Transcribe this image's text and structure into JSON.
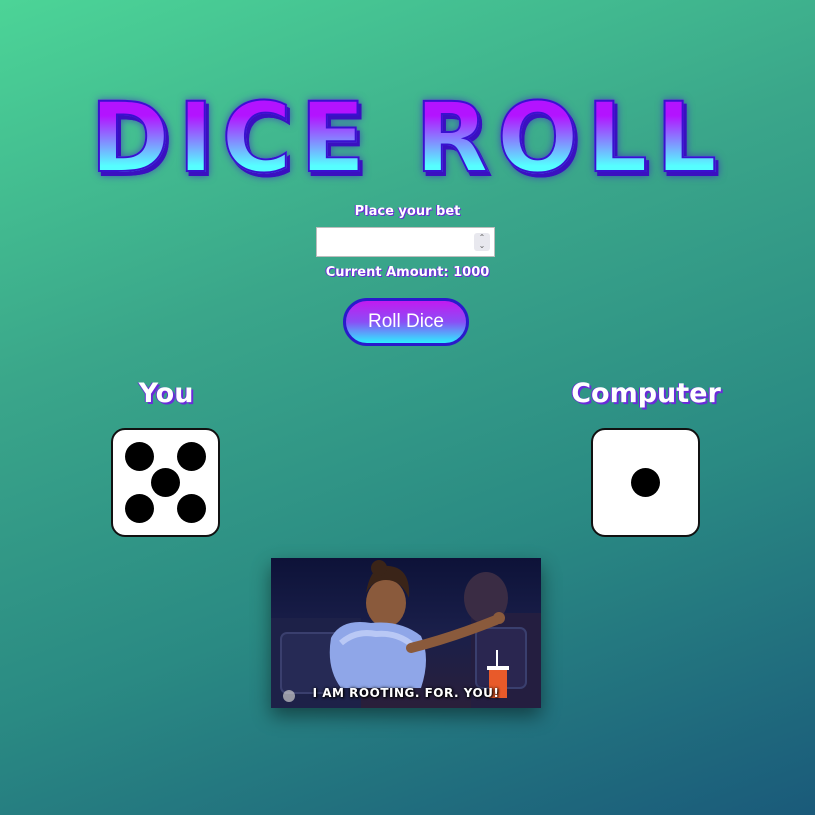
{
  "title": "DICE ROLL",
  "bet": {
    "label": "Place your bet",
    "value": "",
    "amount_line": "Current Amount: 1000"
  },
  "roll_button": {
    "label": "Roll Dice"
  },
  "players": {
    "you": {
      "label": "You",
      "die_value": 5
    },
    "computer": {
      "label": "Computer",
      "die_value": 1
    }
  },
  "gif": {
    "caption": "I AM ROOTING. FOR. YOU!",
    "network_icon": "nbc-peacock-icon"
  },
  "colors": {
    "accent_purple": "#b313ff",
    "accent_cyan": "#55ffff",
    "outline_blue": "#2a1acb"
  }
}
